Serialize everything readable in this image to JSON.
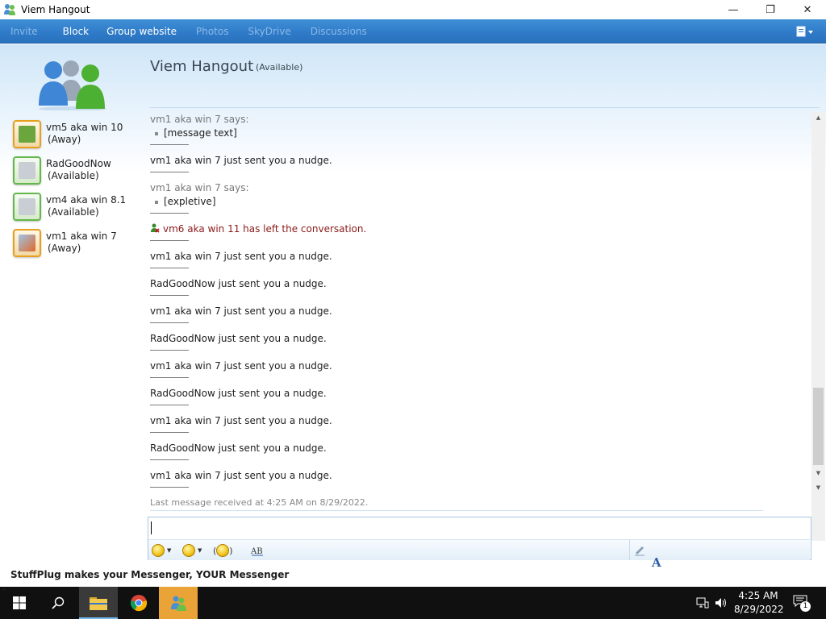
{
  "window": {
    "title": "Viem Hangout",
    "controls": {
      "minimize": "—",
      "maximize": "❐",
      "close": "✕"
    }
  },
  "menu": {
    "items": [
      {
        "label": "Invite",
        "enabled": false
      },
      {
        "label": "Block",
        "enabled": true
      },
      {
        "label": "Group website",
        "enabled": true
      },
      {
        "label": "Photos",
        "enabled": false
      },
      {
        "label": "SkyDrive",
        "enabled": false
      },
      {
        "label": "Discussions",
        "enabled": false
      }
    ]
  },
  "header": {
    "title": "Viem Hangout",
    "status": "(Available)"
  },
  "contacts": [
    {
      "name": "vm5 aka win 10",
      "status": "(Away)",
      "state": "away"
    },
    {
      "name": "RadGoodNow",
      "status": "(Available)",
      "state": "available"
    },
    {
      "name": "vm4 aka win 8.1",
      "status": "(Available)",
      "state": "available"
    },
    {
      "name": "vm1 aka win 7",
      "status": "(Away)",
      "state": "away"
    }
  ],
  "messages": [
    {
      "type": "says",
      "sender_line": "vm1 aka win 7 says:",
      "text": "[message text]"
    },
    {
      "type": "nudge",
      "text": "vm1 aka win 7 just sent you a nudge."
    },
    {
      "type": "says",
      "sender_line": "vm1 aka win 7 says:",
      "text": "[expletive]"
    },
    {
      "type": "left",
      "text": "vm6 aka win 11 has left the conversation."
    },
    {
      "type": "nudge",
      "text": "vm1 aka win 7 just sent you a nudge."
    },
    {
      "type": "nudge",
      "text": "RadGoodNow just sent you a nudge."
    },
    {
      "type": "nudge",
      "text": "vm1 aka win 7 just sent you a nudge."
    },
    {
      "type": "nudge",
      "text": "RadGoodNow just sent you a nudge."
    },
    {
      "type": "nudge",
      "text": "vm1 aka win 7 just sent you a nudge."
    },
    {
      "type": "nudge",
      "text": "RadGoodNow just sent you a nudge."
    },
    {
      "type": "nudge",
      "text": "vm1 aka win 7 just sent you a nudge."
    },
    {
      "type": "nudge",
      "text": "RadGoodNow just sent you a nudge."
    },
    {
      "type": "nudge",
      "text": "vm1 aka win 7 just sent you a nudge."
    }
  ],
  "last_message": "Last message received at 4:25 AM on 8/29/2022.",
  "input": {
    "value": "",
    "tools": [
      "emoticons",
      "winks",
      "nudge",
      "spell-check"
    ]
  },
  "footer": "StuffPlug makes your Messenger, YOUR Messenger",
  "taskbar": {
    "time": "4:25 AM",
    "date": "8/29/2022",
    "notification_count": "1"
  },
  "colors": {
    "menubar": "#2e7ac8",
    "left_message": "#8b1a1a",
    "taskbar": "#101010",
    "active_app": "#e9a337"
  }
}
